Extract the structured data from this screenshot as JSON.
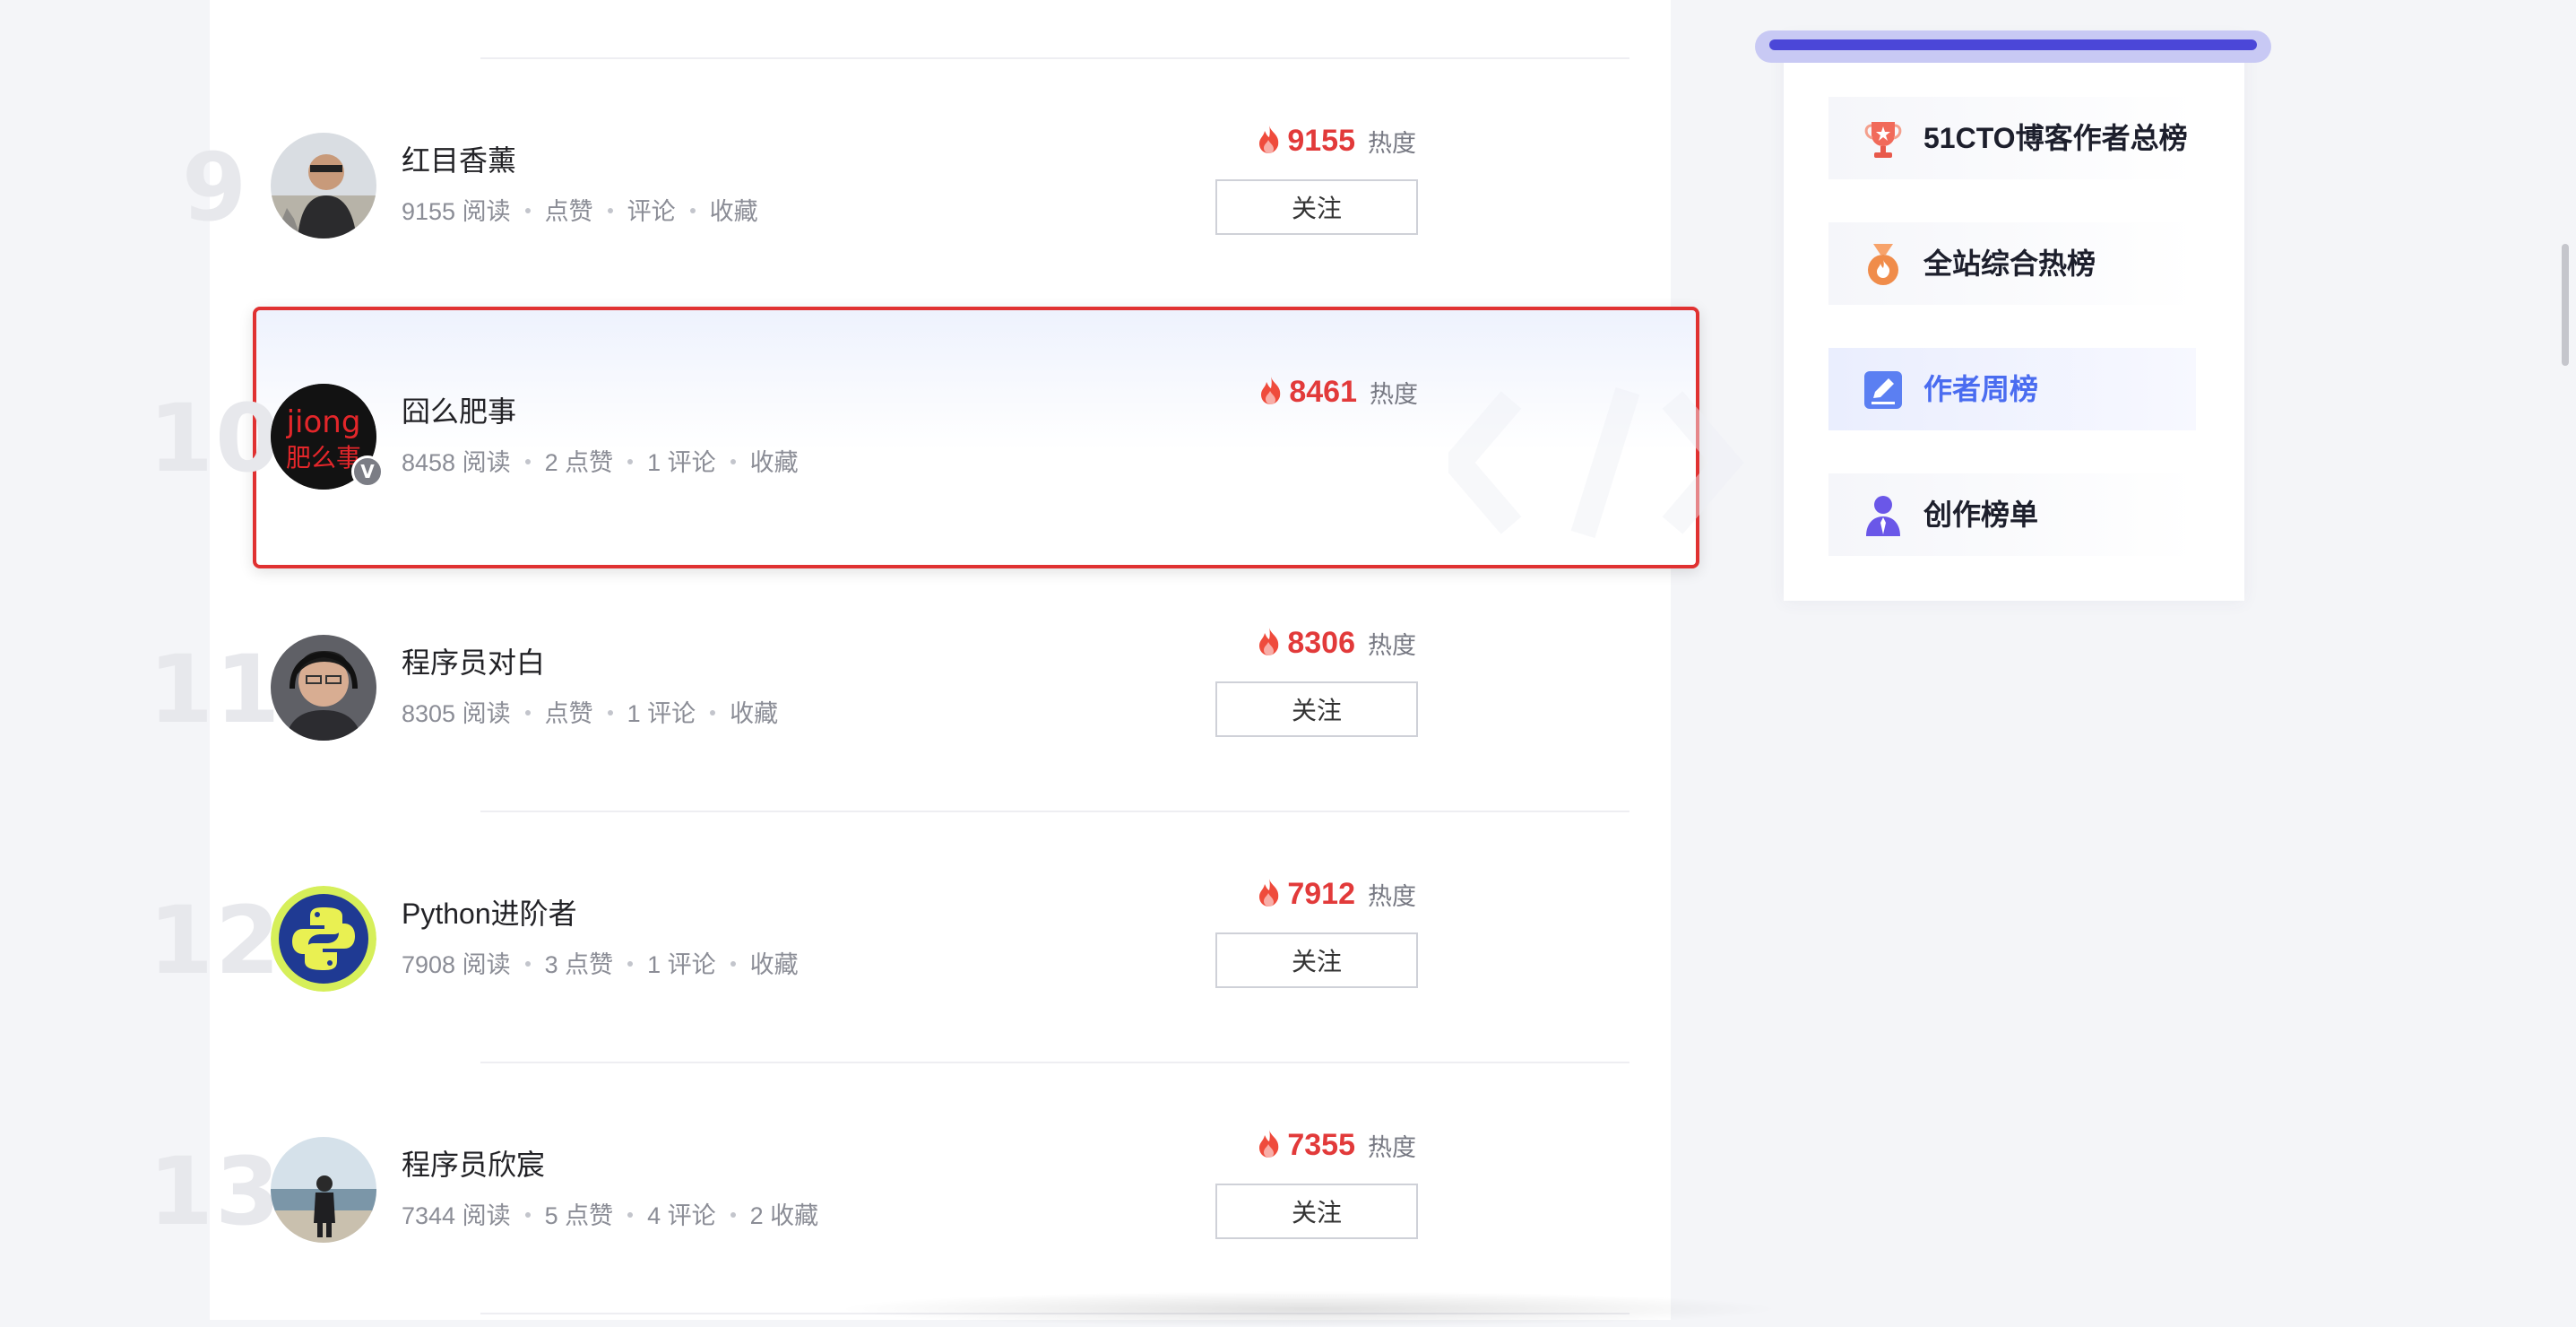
{
  "ranking": {
    "rows": [
      {
        "rank": "9",
        "name": "红目香薰",
        "reads": "9155 阅读",
        "likes": "点赞",
        "comments": "评论",
        "favorites": "收藏",
        "heat": "9155",
        "heat_label": "热度",
        "follow_label": "关注"
      },
      {
        "rank": "10",
        "name": "囧么肥事",
        "reads": "8458 阅读",
        "likes": "2 点赞",
        "comments": "1 评论",
        "favorites": "收藏",
        "heat": "8461",
        "heat_label": "热度",
        "avatar_text_top": "jiong",
        "avatar_text_bottom": "肥么事",
        "badge": "V"
      },
      {
        "rank": "11",
        "name": "程序员对白",
        "reads": "8305 阅读",
        "likes": "点赞",
        "comments": "1 评论",
        "favorites": "收藏",
        "heat": "8306",
        "heat_label": "热度",
        "follow_label": "关注"
      },
      {
        "rank": "12",
        "name": "Python进阶者",
        "reads": "7908 阅读",
        "likes": "3 点赞",
        "comments": "1 评论",
        "favorites": "收藏",
        "heat": "7912",
        "heat_label": "热度",
        "follow_label": "关注"
      },
      {
        "rank": "13",
        "name": "程序员欣宸",
        "reads": "7344 阅读",
        "likes": "5 点赞",
        "comments": "4 评论",
        "favorites": "2 收藏",
        "heat": "7355",
        "heat_label": "热度",
        "follow_label": "关注"
      }
    ]
  },
  "sidebar": {
    "items": [
      {
        "label": "51CTO博客作者总榜",
        "icon": "trophy-icon",
        "active": false
      },
      {
        "label": "全站综合热榜",
        "icon": "medal-icon",
        "active": false
      },
      {
        "label": "作者周榜",
        "icon": "edit-icon",
        "active": true
      },
      {
        "label": "创作榜单",
        "icon": "person-icon",
        "active": false
      }
    ]
  },
  "colors": {
    "heat": "#e23a3a",
    "highlight_border": "#e03131",
    "sidebar_active": "#4a6cf0",
    "sidebar_bar": "#4b47d8"
  }
}
